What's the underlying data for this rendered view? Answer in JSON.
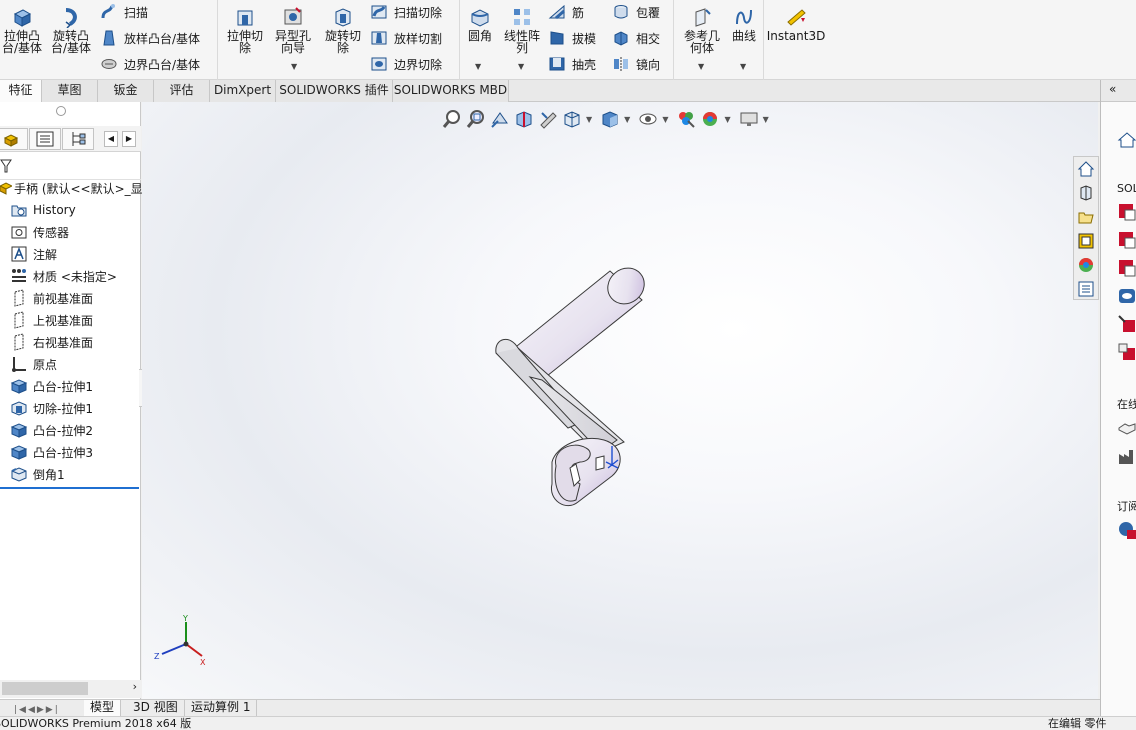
{
  "ribbon": {
    "extrude_boss": [
      "拉伸凸",
      "台/基体"
    ],
    "revolve_boss": [
      "旋转凸",
      "台/基体"
    ],
    "sweep": "扫描",
    "loft_boss": "放样凸台/基体",
    "boundary_boss": "边界凸台/基体",
    "extrude_cut": [
      "拉伸切",
      "除"
    ],
    "hole_wizard": [
      "异型孔",
      "向导"
    ],
    "revolve_cut": [
      "旋转切",
      "除"
    ],
    "sweep_cut": "扫描切除",
    "loft_cut": "放样切割",
    "boundary_cut": "边界切除",
    "fillet": "圆角",
    "linear_pattern": [
      "线性阵",
      "列"
    ],
    "rib": "筋",
    "draft": "拔模",
    "shell": "抽壳",
    "wrap": "包覆",
    "intersect": "相交",
    "mirror": "镜向",
    "ref_geometry": [
      "参考几",
      "何体"
    ],
    "curves": "曲线",
    "instant3d": "Instant3D"
  },
  "tabs": [
    "特征",
    "草图",
    "钣金",
    "评估",
    "DimXpert",
    "SOLIDWORKS 插件",
    "SOLIDWORKS MBD"
  ],
  "tree": {
    "root": "手柄 (默认<<默认>_显",
    "items": [
      {
        "label": "History",
        "icon": "history-folder-icon"
      },
      {
        "label": "传感器",
        "icon": "sensor-icon"
      },
      {
        "label": "注解",
        "icon": "annotation-icon"
      },
      {
        "label": "材质 <未指定>",
        "icon": "material-icon"
      },
      {
        "label": "前视基准面",
        "icon": "plane-icon"
      },
      {
        "label": "上视基准面",
        "icon": "plane-icon"
      },
      {
        "label": "右视基准面",
        "icon": "plane-icon"
      },
      {
        "label": "原点",
        "icon": "origin-icon"
      },
      {
        "label": "凸台-拉伸1",
        "icon": "boss-extrude-icon"
      },
      {
        "label": "切除-拉伸1",
        "icon": "cut-extrude-icon"
      },
      {
        "label": "凸台-拉伸2",
        "icon": "boss-extrude-icon"
      },
      {
        "label": "凸台-拉伸3",
        "icon": "boss-extrude-icon"
      },
      {
        "label": "倒角1",
        "icon": "chamfer-icon"
      }
    ]
  },
  "triad": {
    "y": "Y",
    "z": "Z",
    "x": "X"
  },
  "bottom_tabs": [
    "模型",
    "3D 视图",
    "运动算例 1"
  ],
  "status": {
    "product": "SOLIDWORKS Premium 2018 x64 版",
    "mode": "在编辑 零件"
  },
  "taskpane": {
    "heading1": "SOL",
    "heading2": "在线",
    "heading3": "订阅"
  },
  "colors": {
    "accent": "#1f6fd1",
    "part_face": "#e6e2ee",
    "part_shadow": "#b39fcb",
    "ribbon_bg": "#f5f5f5"
  }
}
